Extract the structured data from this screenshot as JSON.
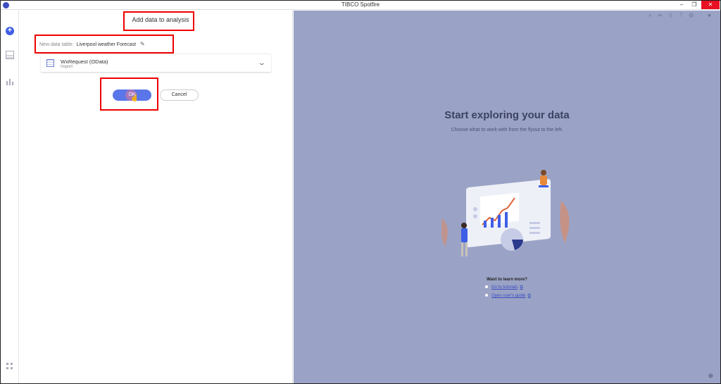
{
  "window": {
    "title": "TIBCO Spotfire",
    "minimize_glyph": "–",
    "maximize_glyph": "❐",
    "close_glyph": "✕"
  },
  "rail": {
    "icons": [
      "add-icon",
      "data-table-icon",
      "visualization-icon",
      "data-canvas-icon"
    ]
  },
  "flyout": {
    "title": "Add data to analysis",
    "new_table_label": "New data table:",
    "new_table_name": "Liverpool weather Forecast",
    "source": {
      "name": "WxRequest (OData)",
      "action": "Import"
    },
    "ok_label": "OK",
    "cancel_label": "Cancel"
  },
  "main": {
    "toolbar_icons": [
      "search-icon",
      "link-icon",
      "bookmark-icon",
      "filter-icon",
      "settings-icon",
      "more-icon",
      "notification-icon"
    ],
    "heading": "Start exploring your data",
    "subheading": "Choose what to work with from the flyout to the left.",
    "learn_more": "Want to learn more?",
    "links": [
      {
        "label": "Go to tutorials"
      },
      {
        "label": "Open user's guide"
      }
    ]
  },
  "colors": {
    "accent": "#5a76e8",
    "canvas": "#9aa3c6",
    "highlight": "#e00000"
  }
}
